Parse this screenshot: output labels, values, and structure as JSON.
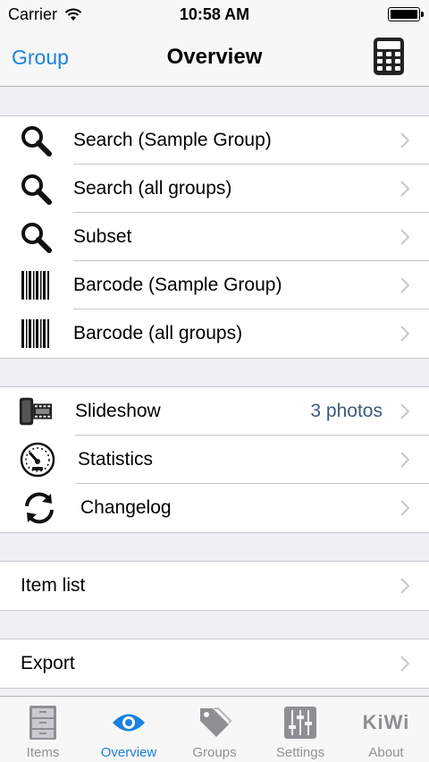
{
  "status_bar": {
    "carrier": "Carrier",
    "time": "10:58 AM"
  },
  "nav": {
    "back_label": "Group",
    "title": "Overview",
    "right_icon": "calculator-icon"
  },
  "section1": [
    {
      "label": "Search (Sample Group)",
      "icon": "search-icon"
    },
    {
      "label": "Search (all groups)",
      "icon": "search-icon"
    },
    {
      "label": "Subset",
      "icon": "search-icon"
    },
    {
      "label": "Barcode (Sample Group)",
      "icon": "barcode-icon"
    },
    {
      "label": "Barcode (all groups)",
      "icon": "barcode-icon"
    }
  ],
  "section2": [
    {
      "label": "Slideshow",
      "detail": "3 photos",
      "icon": "film-icon"
    },
    {
      "label": "Statistics",
      "icon": "speedometer-icon"
    },
    {
      "label": "Changelog",
      "icon": "refresh-icon"
    }
  ],
  "section3": [
    {
      "label": "Item list"
    }
  ],
  "section4": [
    {
      "label": "Export"
    }
  ],
  "tabs": [
    {
      "label": "Items",
      "icon": "cabinet-icon"
    },
    {
      "label": "Overview",
      "icon": "eye-icon",
      "active": true
    },
    {
      "label": "Groups",
      "icon": "tag-icon"
    },
    {
      "label": "Settings",
      "icon": "sliders-icon"
    },
    {
      "label": "About",
      "icon": "kiwi-logo",
      "logo_text": "KiWi"
    }
  ],
  "colors": {
    "accent": "#1a82e0",
    "detail": "#3f5a7a",
    "tab_inactive": "#929292"
  }
}
